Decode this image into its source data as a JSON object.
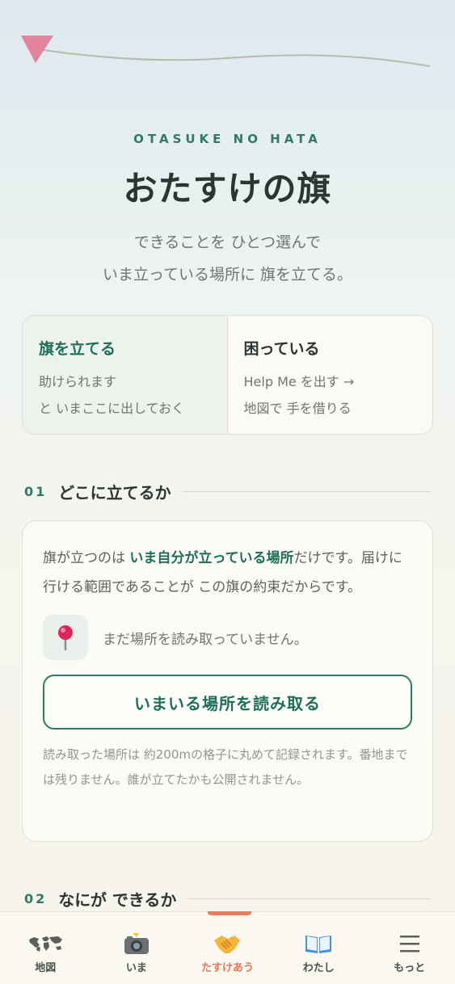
{
  "header": {
    "eyebrow": "OTASUKE NO HATA",
    "title": "おたすけの旗",
    "lead_line1": "できることを ひとつ選んで",
    "lead_line2": "いま立っている場所に 旗を立てる。"
  },
  "modes": [
    {
      "title": "旗を立てる",
      "desc1": "助けられます",
      "desc2": "と いまここに出しておく",
      "selected": true
    },
    {
      "title": "困っている",
      "desc1": "Help Me を出す →",
      "desc2": "地図で 手を借りる",
      "selected": false
    }
  ],
  "section1": {
    "num": "01",
    "title": "どこに立てるか",
    "text_pre": "旗が立つのは ",
    "text_bold": "いま自分が立っている場所",
    "text_post": "だけです。届けに行ける範囲であることが この旗の約束だからです。",
    "location_status": "まだ場所を読み取っていません。",
    "button_label": "いまいる場所を読み取る",
    "note": "読み取った場所は 約200mの格子に丸めて記録されます。番地までは残りません。誰が立てたかも公開されません。"
  },
  "section2": {
    "num": "02",
    "title": "なにが できるか"
  },
  "tabbar": [
    {
      "label": "地図",
      "icon": "world-map-icon",
      "active": false
    },
    {
      "label": "いま",
      "icon": "camera-flash-icon",
      "active": false
    },
    {
      "label": "たすけあう",
      "icon": "handshake-icon",
      "active": true
    },
    {
      "label": "わたし",
      "icon": "open-book-icon",
      "active": false
    },
    {
      "label": "もっと",
      "icon": "menu-icon",
      "active": false
    }
  ],
  "colors": {
    "accent": "#2f7a66",
    "active_tab": "#e97551",
    "flag": "#e2849b"
  }
}
